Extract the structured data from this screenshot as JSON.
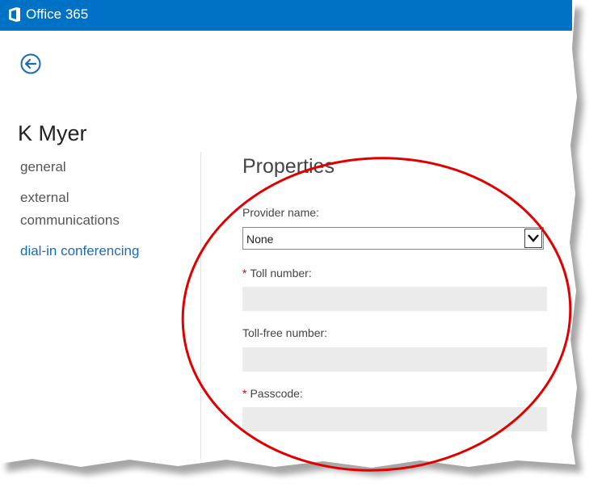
{
  "app": {
    "title": "Office 365"
  },
  "header": {
    "back_icon": "arrow-left-circle-icon"
  },
  "user": {
    "name": "K Myer"
  },
  "nav": {
    "items": [
      {
        "label": "general"
      },
      {
        "label": "external communications",
        "line1": "external",
        "line2": "communications"
      },
      {
        "label": "dial-in conferencing",
        "active": true
      }
    ]
  },
  "properties": {
    "title": "Properties",
    "provider": {
      "label": "Provider name:",
      "value": "None"
    },
    "toll": {
      "required_mark": "*",
      "label": "Toll number:",
      "value": ""
    },
    "toll_free": {
      "label": "Toll-free number:",
      "value": ""
    },
    "passcode": {
      "required_mark": "*",
      "label": "Passcode:",
      "value": ""
    }
  },
  "colors": {
    "brand": "#0072c6",
    "link": "#1a6cb2",
    "required": "#d00000",
    "annotation": "#e00000",
    "field_bg": "#ebebeb"
  }
}
